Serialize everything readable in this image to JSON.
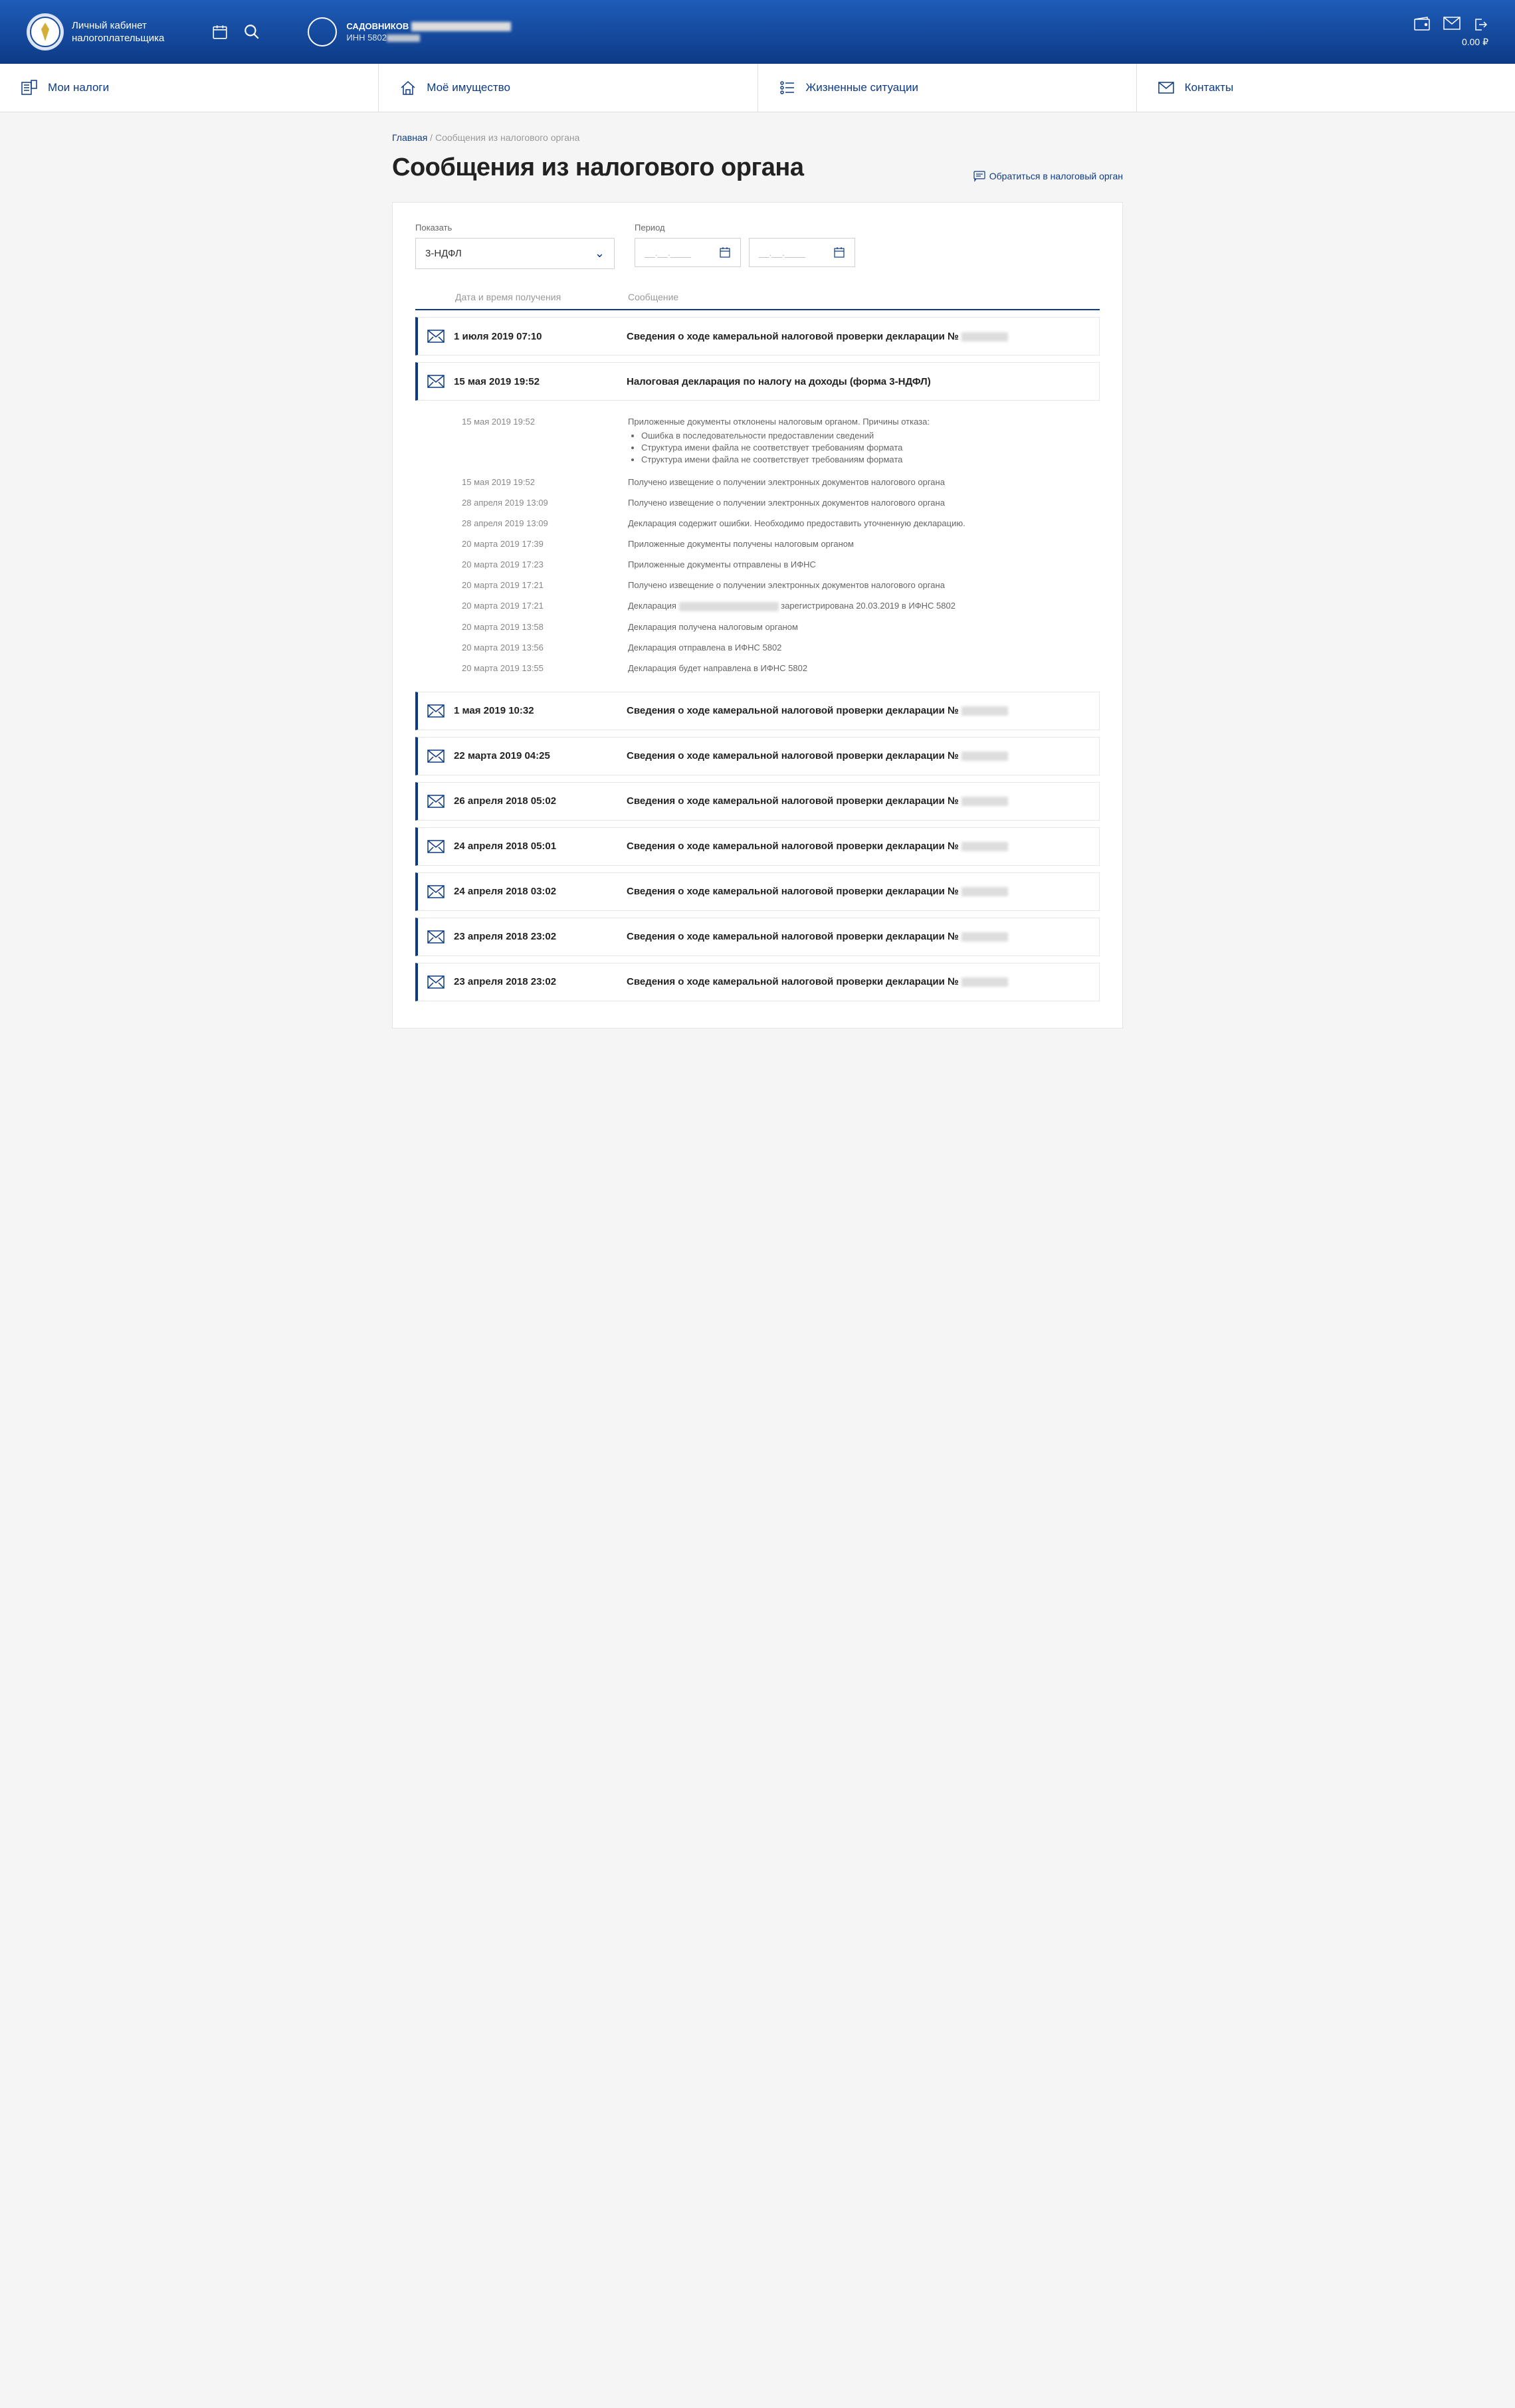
{
  "header": {
    "app_title_line1": "Личный кабинет",
    "app_title_line2": "налогоплательщика",
    "user_name": "САДОВНИКОВ",
    "user_inn_label": "ИНН 5802",
    "balance": "0.00 ₽"
  },
  "nav": {
    "taxes": "Мои налоги",
    "property": "Моё имущество",
    "situations": "Жизненные ситуации",
    "contacts": "Контакты"
  },
  "breadcrumb": {
    "home": "Главная",
    "sep": " / ",
    "current": "Сообщения из налогового органа"
  },
  "page_title": "Сообщения из налогового органа",
  "contact_link": "Обратиться в налоговый орган",
  "filters": {
    "show_label": "Показать",
    "show_value": "3-НДФЛ",
    "period_label": "Период",
    "date_placeholder": "__.__.____"
  },
  "columns": {
    "date": "Дата и время получения",
    "message": "Сообщение"
  },
  "messages": [
    {
      "date": "1 июля 2019 07:10",
      "subject": "Сведения о ходе камеральной налоговой проверки декларации №"
    },
    {
      "date": "15 мая 2019 19:52",
      "subject": "Налоговая декларация по налогу на доходы (форма 3-НДФЛ)"
    },
    {
      "date": "1 мая 2019 10:32",
      "subject": "Сведения о ходе камеральной налоговой проверки декларации №"
    },
    {
      "date": "22 марта 2019 04:25",
      "subject": "Сведения о ходе камеральной налоговой проверки декларации №"
    },
    {
      "date": "26 апреля 2018 05:02",
      "subject": "Сведения о ходе камеральной налоговой проверки декларации №"
    },
    {
      "date": "24 апреля 2018 05:01",
      "subject": "Сведения о ходе камеральной налоговой проверки декларации №"
    },
    {
      "date": "24 апреля 2018 03:02",
      "subject": "Сведения о ходе камеральной налоговой проверки декларации №"
    },
    {
      "date": "23 апреля 2018 23:02",
      "subject": "Сведения о ходе камеральной налоговой проверки декларации №"
    },
    {
      "date": "23 апреля 2018 23:02",
      "subject": "Сведения о ходе камеральной налоговой проверки декларации №"
    }
  ],
  "history": [
    {
      "date": "15 мая 2019 19:52",
      "text": "Приложенные документы отклонены налоговым органом. Причины отказа:",
      "bullets": [
        "Ошибка в последовательности предоставлении сведений",
        "Структура имени файла не соответствует требованиям формата",
        "Структура имени файла не соответствует требованиям формата"
      ]
    },
    {
      "date": "15 мая 2019 19:52",
      "text": "Получено извещение о получении электронных документов налогового органа"
    },
    {
      "date": "28 апреля 2019 13:09",
      "text": "Получено извещение о получении электронных документов налогового органа"
    },
    {
      "date": "28 апреля 2019 13:09",
      "text": "Декларация содержит ошибки. Необходимо предоставить уточненную декларацию."
    },
    {
      "date": "20 марта 2019 17:39",
      "text": "Приложенные документы получены налоговым органом"
    },
    {
      "date": "20 марта 2019 17:23",
      "text": "Приложенные документы отправлены в ИФНС"
    },
    {
      "date": "20 марта 2019 17:21",
      "text": "Получено извещение о получении электронных документов налогового органа"
    },
    {
      "date": "20 марта 2019 17:21",
      "text_pre": "Декларация ",
      "text_post": " зарегистрирована 20.03.2019 в ИФНС 5802",
      "redacted": true
    },
    {
      "date": "20 марта 2019 13:58",
      "text": "Декларация получена налоговым органом"
    },
    {
      "date": "20 марта 2019 13:56",
      "text": "Декларация отправлена в ИФНС 5802"
    },
    {
      "date": "20 марта 2019 13:55",
      "text": "Декларация будет направлена в ИФНС 5802"
    }
  ]
}
